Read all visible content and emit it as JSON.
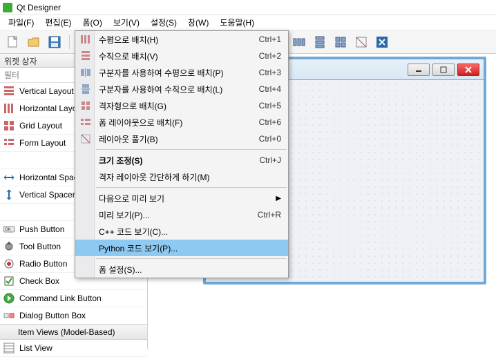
{
  "titlebar": {
    "title": "Qt Designer"
  },
  "menubar": {
    "items": [
      {
        "label": "파일(F)",
        "u": "F"
      },
      {
        "label": "편집(E)",
        "u": "E"
      },
      {
        "label": "폼(O)",
        "u": "O"
      },
      {
        "label": "보기(V)",
        "u": "V"
      },
      {
        "label": "설정(S)",
        "u": "S"
      },
      {
        "label": "창(W)",
        "u": "W"
      },
      {
        "label": "도움말(H)",
        "u": "H"
      }
    ]
  },
  "sidebar": {
    "header": "위젯 상자",
    "filter_placeholder": "필터",
    "items": [
      {
        "name": "Vertical Layout",
        "icon": "vlayout"
      },
      {
        "name": "Horizontal Layout",
        "icon": "hlayout"
      },
      {
        "name": "Grid Layout",
        "icon": "grid"
      },
      {
        "name": "Form Layout",
        "icon": "form"
      }
    ],
    "spacers": [
      {
        "name": "Horizontal Spacer",
        "icon": "hspacer"
      },
      {
        "name": "Vertical Spacer",
        "icon": "vspacer"
      }
    ],
    "buttons": [
      {
        "name": "Push Button",
        "icon": "pushbtn"
      },
      {
        "name": "Tool Button",
        "icon": "toolbtn"
      },
      {
        "name": "Radio Button",
        "icon": "radio"
      },
      {
        "name": "Check Box",
        "icon": "check"
      },
      {
        "name": "Command Link Button",
        "icon": "cmdlink"
      },
      {
        "name": "Dialog Button Box",
        "icon": "dialogbox"
      }
    ],
    "category": "Item Views (Model-Based)",
    "views": [
      {
        "name": "List View",
        "icon": "listview"
      }
    ]
  },
  "dropdown": {
    "groups": [
      [
        {
          "label": "수평으로 배치(H)",
          "shortcut": "Ctrl+1",
          "icon": "hlayout"
        },
        {
          "label": "수직으로 배치(V)",
          "shortcut": "Ctrl+2",
          "icon": "vlayout"
        },
        {
          "label": "구분자를 사용하여 수평으로 배치(P)",
          "shortcut": "Ctrl+3",
          "icon": "hsplit"
        },
        {
          "label": "구분자를 사용하여 수직으로 배치(L)",
          "shortcut": "Ctrl+4",
          "icon": "vsplit"
        },
        {
          "label": "격자형으로 배치(G)",
          "shortcut": "Ctrl+5",
          "icon": "grid"
        },
        {
          "label": "폼 레이아웃으로 배치(F)",
          "shortcut": "Ctrl+6",
          "icon": "form"
        },
        {
          "label": "레이아웃 풀기(B)",
          "shortcut": "Ctrl+0",
          "icon": "break"
        }
      ],
      [
        {
          "label": "크기 조정(S)",
          "shortcut": "Ctrl+J",
          "bold": true
        },
        {
          "label": "격자 레이아웃 간단하게 하기(M)",
          "shortcut": ""
        }
      ],
      [
        {
          "label": "다음으로 미리 보기",
          "shortcut": "",
          "submenu": true
        },
        {
          "label": "미리 보기(P)...",
          "shortcut": "Ctrl+R"
        },
        {
          "label": "C++ 코드 보기(C)...",
          "shortcut": ""
        },
        {
          "label": "Python 코드 보기(P)...",
          "shortcut": "",
          "highlight": true
        }
      ],
      [
        {
          "label": "폼 설정(S)...",
          "shortcut": ""
        }
      ]
    ]
  }
}
